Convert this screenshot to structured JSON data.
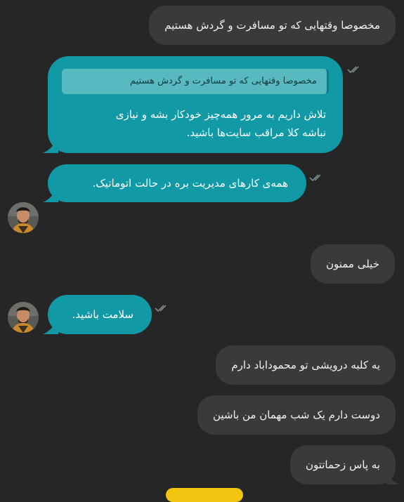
{
  "messages": {
    "m1": {
      "text": "مخصوصا وقتهایی که تو مسافرت و گردش هستیم"
    },
    "m2": {
      "quote": "مخصوصا وقتهایی که تو مسافرت و گردش هستیم",
      "line1": "تلاش داریم به مرور همه‌چیز خودکار بشه و نیازی",
      "line2": "نباشه کلا مراقب سایت‌ها باشید."
    },
    "m3": {
      "text": "همه‌ی کارهای مدیریت بره در حالت اتوماتیک."
    },
    "m4": {
      "text": "خیلی ممنون"
    },
    "m5": {
      "text": "سلامت باشید."
    },
    "m6": {
      "text": "یه کلبه درویشی تو محموداباد دارم"
    },
    "m7": {
      "text": "دوست دارم یک شب مهمان من باشین"
    },
    "m8": {
      "text": "به پاس زحماتتون"
    }
  },
  "colors": {
    "background": "#262626",
    "sent_bubble": "#3a3a3a",
    "received_bubble": "#119aa6",
    "quote_block": "#58b9c1"
  },
  "icons": {
    "read_receipt": "double-check-icon",
    "avatar": "user-avatar"
  }
}
